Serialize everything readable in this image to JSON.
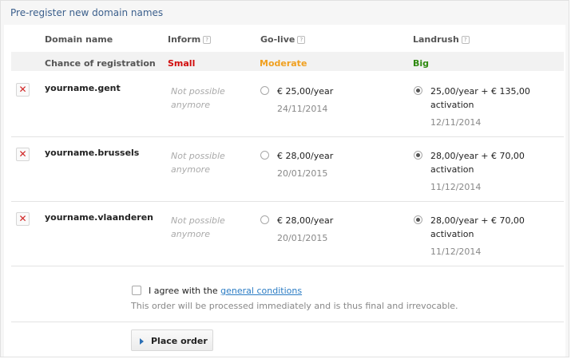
{
  "panel_title": "Pre-register new domain names",
  "headers": {
    "domain": "Domain name",
    "inform": "Inform",
    "golive": "Go-live",
    "landrush": "Landrush"
  },
  "chance": {
    "label": "Chance of registration",
    "small": "Small",
    "moderate": "Moderate",
    "big": "Big",
    "colors": {
      "small": "#d10b0b",
      "moderate": "#f0a020",
      "big": "#2f8a10"
    }
  },
  "domains": [
    {
      "name": "yourname.gent",
      "inform": "Not possible anymore",
      "golive": {
        "price": "€ 25,00/year",
        "date": "24/11/2014",
        "selected": false
      },
      "landrush": {
        "price": "25,00/year + € 135,00",
        "activation": "activation",
        "date": "12/11/2014",
        "selected": true
      }
    },
    {
      "name": "yourname.brussels",
      "inform": "Not possible anymore",
      "golive": {
        "price": "€ 28,00/year",
        "date": "20/01/2015",
        "selected": false
      },
      "landrush": {
        "price": "28,00/year + € 70,00",
        "activation": "activation",
        "date": "11/12/2014",
        "selected": true
      }
    },
    {
      "name": "yourname.vlaanderen",
      "inform": "Not possible anymore",
      "golive": {
        "price": "€ 28,00/year",
        "date": "20/01/2015",
        "selected": false
      },
      "landrush": {
        "price": "28,00/year + € 70,00",
        "activation": "activation",
        "date": "11/12/2014",
        "selected": true
      }
    }
  ],
  "agree": {
    "prefix": "I agree with the ",
    "link": "general conditions",
    "note": "This order will be processed immediately and is thus final and irrevocable.",
    "checked": false
  },
  "place_order": "Place order",
  "icons": {
    "delete": "close-x-icon",
    "help": "help-icon",
    "play": "play-arrow-icon"
  }
}
